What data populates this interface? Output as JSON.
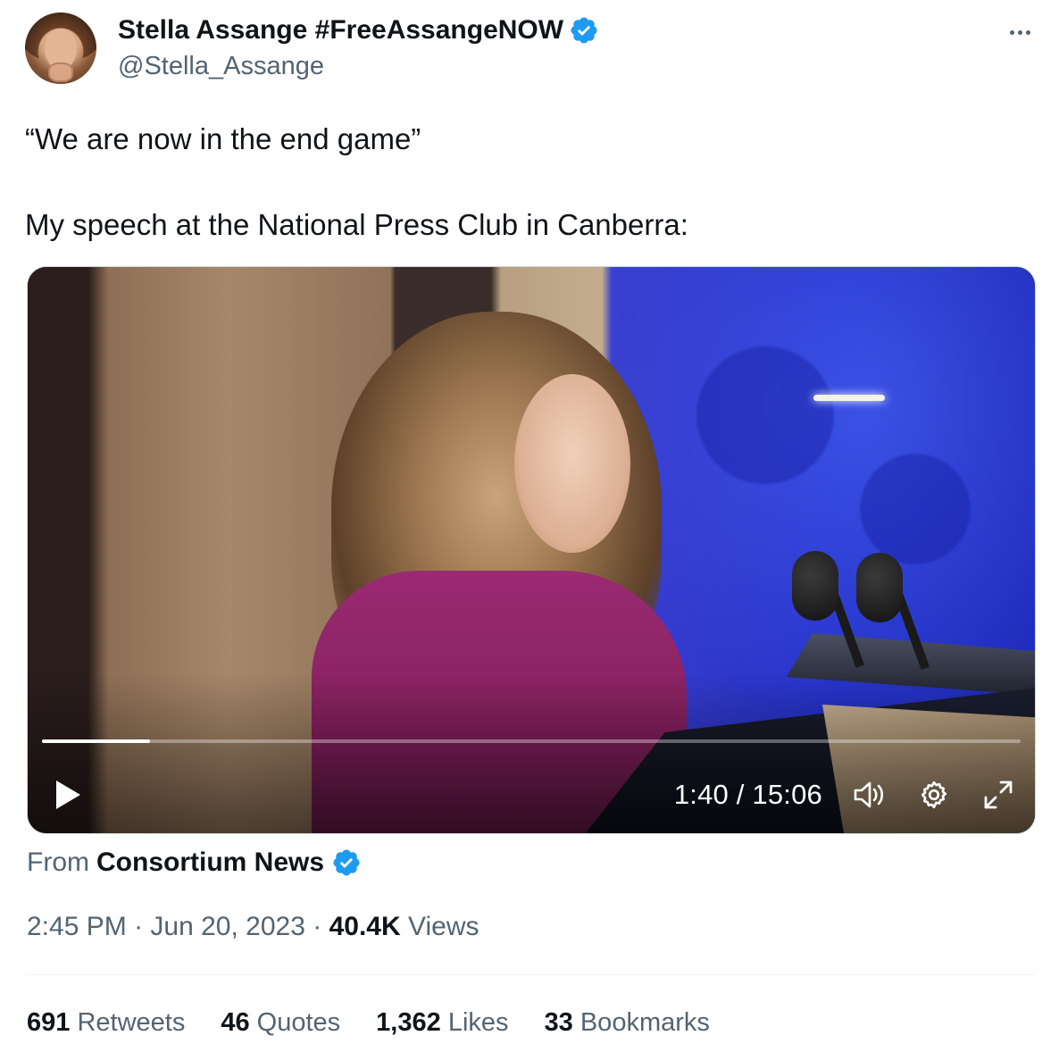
{
  "author": {
    "display_name": "Stella Assange #FreeAssangeNOW",
    "handle": "@Stella_Assange",
    "verified_icon": "verified-badge-icon"
  },
  "menu": {
    "icon": "more-horizontal-icon"
  },
  "tweet": {
    "line1": "“We are now in the end game”",
    "line2": "My speech at the National Press Club in Canberra:"
  },
  "video": {
    "current_time": "1:40",
    "separator": "/",
    "duration": "15:06",
    "time_display": "1:40 / 15:06",
    "progress_fraction": 0.11,
    "icons": [
      "play-icon",
      "volume-icon",
      "settings-gear-icon",
      "fullscreen-expand-icon"
    ]
  },
  "source": {
    "prefix": "From",
    "name": "Consortium News"
  },
  "meta": {
    "time": "2:45 PM",
    "dot": "·",
    "date": "Jun 20, 2023",
    "views_count": "40.4K",
    "views_label": "Views"
  },
  "stats": {
    "retweets_count": "691",
    "retweets_label": "Retweets",
    "quotes_count": "46",
    "quotes_label": "Quotes",
    "likes_count": "1,362",
    "likes_label": "Likes",
    "bookmarks_count": "33",
    "bookmarks_label": "Bookmarks"
  },
  "colors": {
    "text_primary": "#0f1419",
    "text_secondary": "#536471",
    "verified_blue": "#1d9bf0",
    "divider": "#eff3f4"
  }
}
